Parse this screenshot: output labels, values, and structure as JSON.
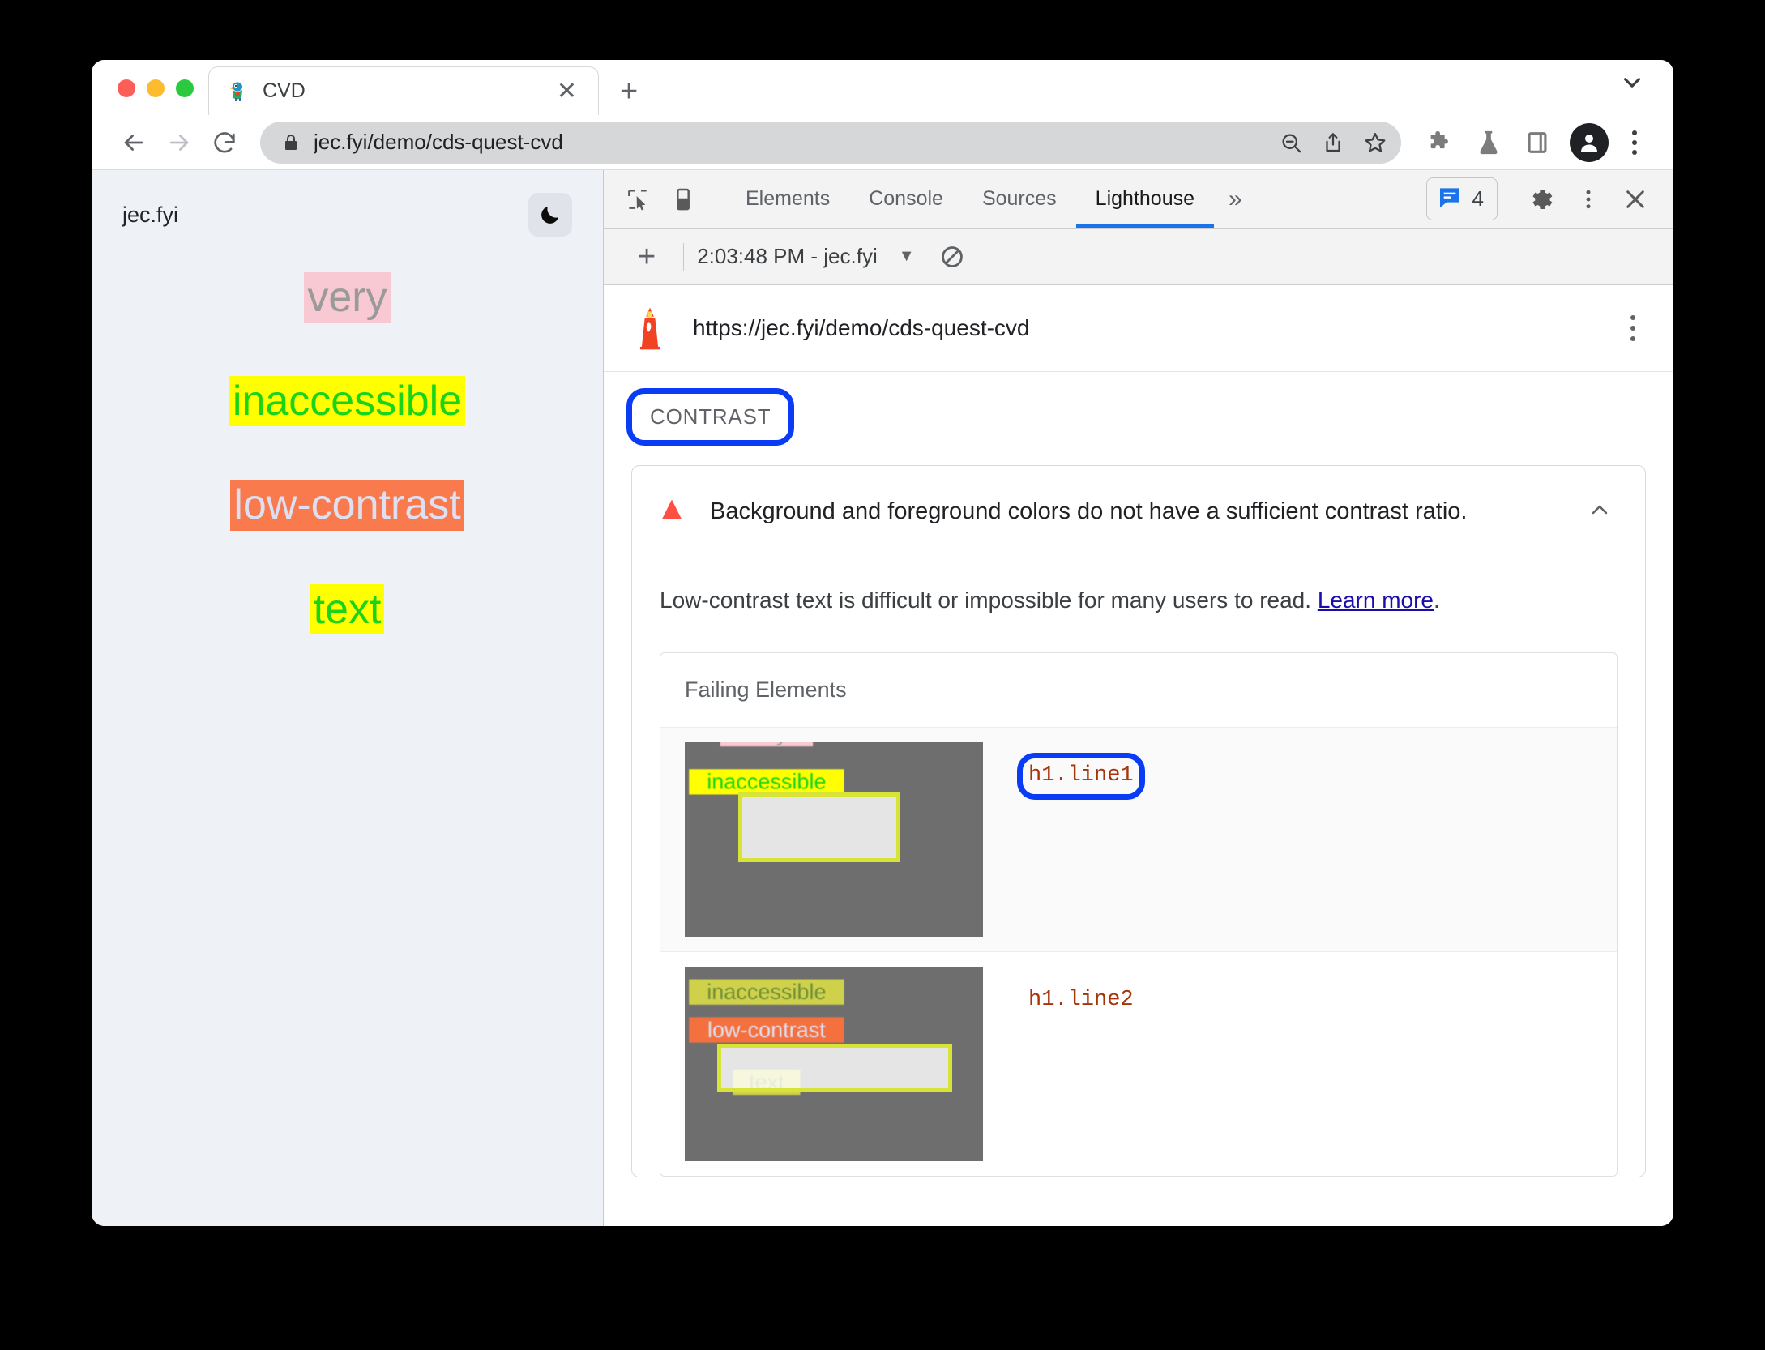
{
  "browser": {
    "tab": {
      "title": "CVD",
      "favicon_icon": "parrot-favicon",
      "close_icon": "close-icon"
    },
    "new_tab_icon": "plus-icon",
    "tabstrip_chevron_icon": "chevron-down-icon",
    "nav": {
      "back_icon": "arrow-left-icon",
      "forward_icon": "arrow-right-icon",
      "reload_icon": "reload-icon"
    },
    "omnibox": {
      "lock_icon": "lock-icon",
      "url": "jec.fyi/demo/cds-quest-cvd",
      "zoom_icon": "zoom-out-icon",
      "share_icon": "share-icon",
      "bookmark_icon": "star-icon"
    },
    "toolbar_icons": {
      "extensions": "puzzle-icon",
      "experiments": "flask-icon",
      "side_panel": "side-panel-icon",
      "profile": "avatar-person-icon",
      "menu": "kebab-menu-icon"
    }
  },
  "page": {
    "site_name": "jec.fyi",
    "dark_mode_icon": "moon-icon",
    "lines": [
      {
        "text": "very",
        "color": "#9a9a9a",
        "background": "#f8c8d3"
      },
      {
        "text": "inaccessible",
        "color": "#1ad41a",
        "background": "#ffff00"
      },
      {
        "text": "low-contrast",
        "color": "#dde0f2",
        "background": "#f97a4d"
      },
      {
        "text": "text",
        "color": "#1ad41a",
        "background": "#ffff00"
      }
    ]
  },
  "devtools": {
    "inspect_icon": "inspect-cursor-icon",
    "device_toggle_icon": "device-toolbar-icon",
    "tabs": [
      {
        "label": "Elements",
        "active": false
      },
      {
        "label": "Console",
        "active": false
      },
      {
        "label": "Sources",
        "active": false
      },
      {
        "label": "Lighthouse",
        "active": true
      }
    ],
    "more_tabs_label": "»",
    "issues": {
      "icon": "issues-speech-bubble-icon",
      "count": "4"
    },
    "settings_icon": "gear-icon",
    "kebab_icon": "kebab-menu-icon",
    "close_icon": "close-icon"
  },
  "lighthouse": {
    "new_report_icon": "plus-icon",
    "report_label": "2:03:48 PM - jec.fyi",
    "dropdown_icon": "caret-down-icon",
    "clear_icon": "no-entry-icon",
    "report_url": "https://jec.fyi/demo/cds-quest-cvd",
    "lighthouse_logo_icon": "lighthouse-icon",
    "report_kebab_icon": "kebab-menu-icon",
    "category_badge": "CONTRAST",
    "audit": {
      "warn_icon": "warning-triangle-icon",
      "title": "Background and foreground colors do not have a sufficient contrast ratio.",
      "collapse_icon": "chevron-up-icon",
      "description_before": "Low-contrast text is difficult or impossible for many users to read. ",
      "learn_more": "Learn more",
      "description_after": ".",
      "failing_elements_title": "Failing Elements",
      "failing_elements": [
        {
          "selector": "h1.line1",
          "annotated": true
        },
        {
          "selector": "h1.line2",
          "annotated": false
        }
      ]
    }
  },
  "annotations": {
    "ring_color": "#0a3bf5",
    "targets": [
      "CONTRAST",
      "h1.line1"
    ]
  }
}
